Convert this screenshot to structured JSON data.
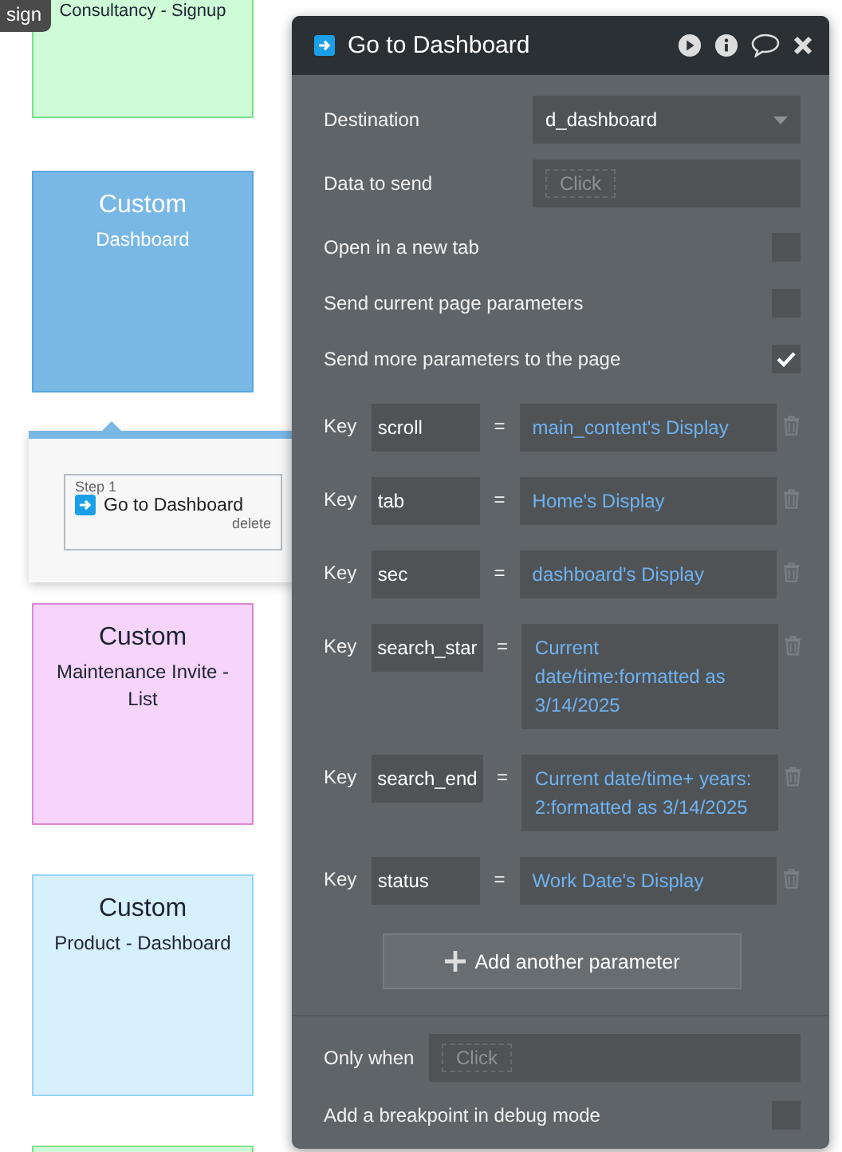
{
  "canvas": {
    "tooltip": "sign",
    "cards": [
      {
        "subtitle": "Consultancy - Signup",
        "color": "#cefcd6",
        "selected": false
      },
      {
        "title": "Custom",
        "subtitle": "Dashboard",
        "color": "#79b8e5",
        "selected": true
      },
      {
        "title": "Custom",
        "subtitle": "Maintenance Invite - List",
        "color": "#f6d4fc",
        "selected": false
      },
      {
        "title": "Custom",
        "subtitle": "Product - Dashboard",
        "color": "#d7f0fd",
        "selected": false
      },
      {
        "color": "#cefcd6",
        "selected": false
      }
    ],
    "workflow": {
      "step": "Step 1",
      "action": "Go to Dashboard",
      "delete": "delete"
    }
  },
  "panel": {
    "title": "Go to Dashboard",
    "destination": {
      "label": "Destination",
      "value": "d_dashboard"
    },
    "data_to_send": {
      "label": "Data to send",
      "placeholder": "Click"
    },
    "options": [
      {
        "label": "Open in a new tab",
        "checked": false
      },
      {
        "label": "Send current page parameters",
        "checked": false
      },
      {
        "label": "Send more parameters to the page",
        "checked": true
      }
    ],
    "parameters": [
      {
        "label": "Key",
        "key": "scroll",
        "equals": "=",
        "value": "main_content's Display"
      },
      {
        "label": "Key",
        "key": "tab",
        "equals": "=",
        "value": "Home's Display"
      },
      {
        "label": "Key",
        "key": "sec",
        "equals": "=",
        "value": "dashboard's Display"
      },
      {
        "label": "Key",
        "key": "search_star",
        "equals": "=",
        "value": "Current date/time:formatted as 3/14/2025"
      },
      {
        "label": "Key",
        "key": "search_end",
        "equals": "=",
        "value": "Current date/time+ years: 2:formatted as 3/14/2025"
      },
      {
        "label": "Key",
        "key": "status",
        "equals": "=",
        "value": "Work Date's Display"
      }
    ],
    "add_button": "Add another parameter",
    "only_when": {
      "label": "Only when",
      "placeholder": "Click"
    },
    "breakpoint": {
      "label": "Add a breakpoint in debug mode",
      "checked": false
    }
  }
}
